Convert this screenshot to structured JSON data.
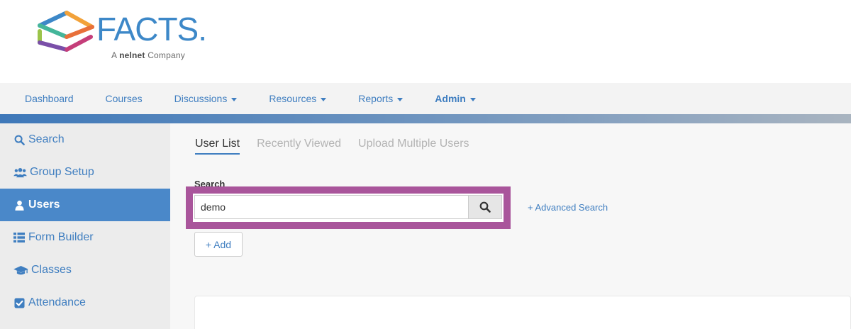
{
  "logo": {
    "wordmark": "FACTS",
    "tagline_prefix": "A",
    "tagline_brand": "nelnet",
    "tagline_suffix": "Company"
  },
  "topnav": {
    "items": [
      {
        "label": "Dashboard",
        "dropdown": false
      },
      {
        "label": "Courses",
        "dropdown": false
      },
      {
        "label": "Discussions",
        "dropdown": true
      },
      {
        "label": "Resources",
        "dropdown": true
      },
      {
        "label": "Reports",
        "dropdown": true
      },
      {
        "label": "Admin",
        "dropdown": true,
        "active": true
      }
    ]
  },
  "sidebar": {
    "items": [
      {
        "label": "Search",
        "icon": "search-icon"
      },
      {
        "label": "Group Setup",
        "icon": "users-group-icon"
      },
      {
        "label": "Users",
        "icon": "user-icon",
        "active": true
      },
      {
        "label": "Form Builder",
        "icon": "list-icon"
      },
      {
        "label": "Classes",
        "icon": "graduation-cap-icon"
      },
      {
        "label": "Attendance",
        "icon": "checkbox-icon"
      }
    ]
  },
  "tabs": [
    {
      "label": "User List",
      "active": true
    },
    {
      "label": "Recently Viewed"
    },
    {
      "label": "Upload Multiple Users"
    }
  ],
  "search": {
    "label": "Search",
    "value": "demo",
    "advanced_label": "+ Advanced Search"
  },
  "add_label": "+ Add",
  "colors": {
    "accent": "#3f7ec0",
    "active_sidebar": "#4a88c9",
    "highlight": "#a9559b"
  }
}
